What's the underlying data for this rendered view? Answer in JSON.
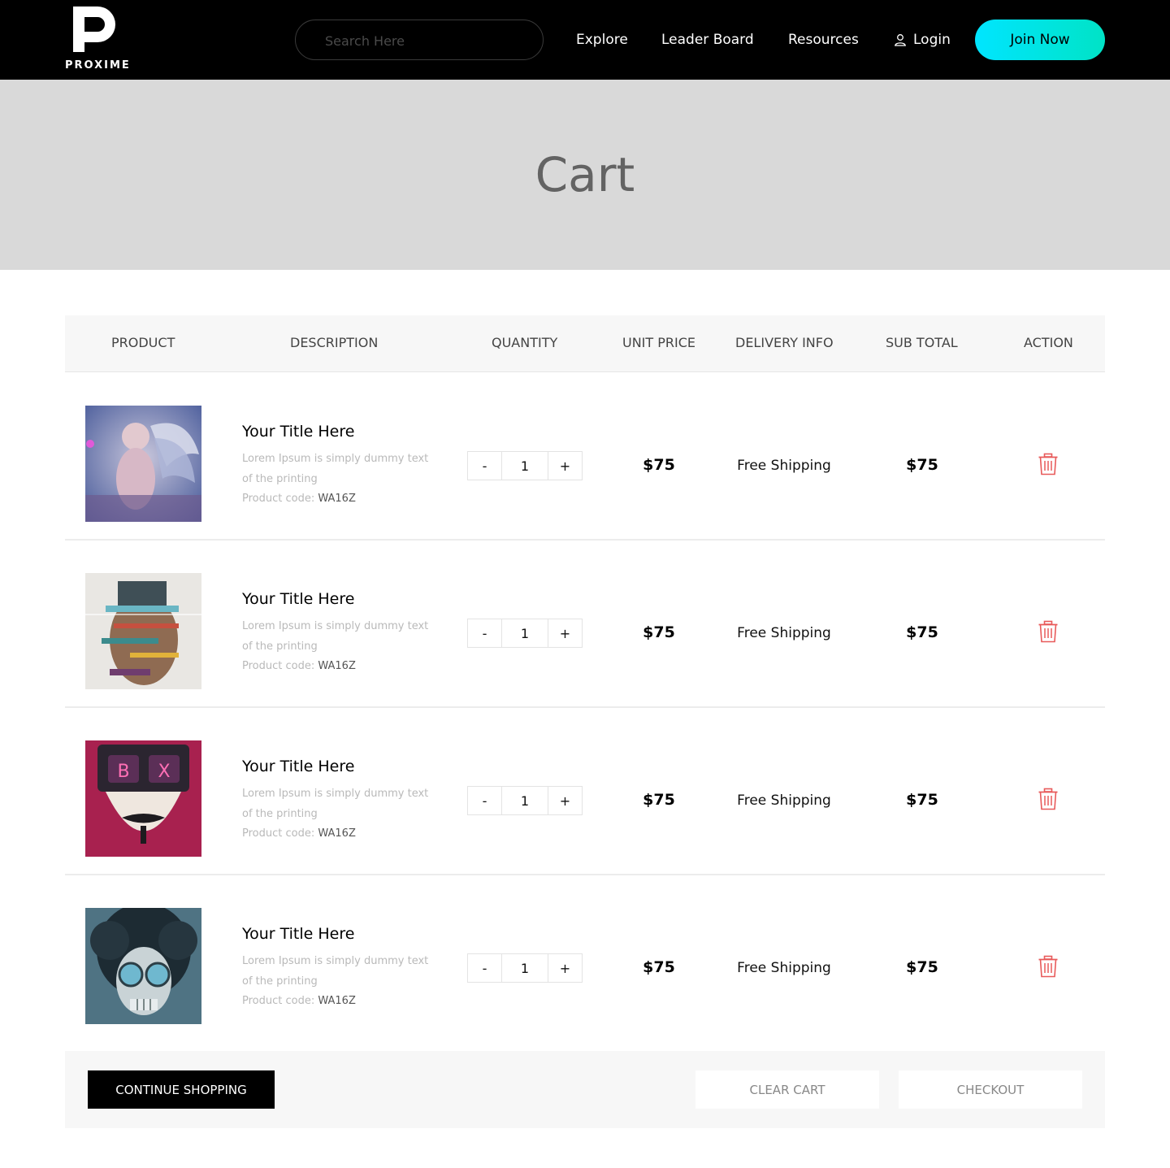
{
  "header": {
    "logo_text": "PROXIME",
    "search_placeholder": "Search Here",
    "nav": {
      "explore": "Explore",
      "leader_board": "Leader Board",
      "resources": "Resources",
      "login": "Login"
    },
    "join_label": "Join Now",
    "join_gradient": [
      "#00e5ff",
      "#00e3c6"
    ]
  },
  "banner": {
    "title": "Cart"
  },
  "table": {
    "headers": {
      "product": "PRODUCT",
      "description": "DESCRIPTION",
      "quantity": "QUANTITY",
      "unit_price": "UNIT PRICE",
      "delivery_info": "DELIVERY INFO",
      "sub_total": "SUB TOTAL",
      "action": "ACTION"
    },
    "rows": [
      {
        "title": "Your Title Here",
        "desc": "Lorem Ipsum is simply dummy text of the printing",
        "code_label": "Product code:",
        "code": "WA16Z",
        "qty": "1",
        "unit_price": "$75",
        "delivery": "Free Shipping",
        "sub_total": "$75",
        "image": "angel-baby-art"
      },
      {
        "title": "Your Title Here",
        "desc": "Lorem Ipsum is simply dummy text of the printing",
        "code_label": "Product code:",
        "code": "WA16Z",
        "qty": "1",
        "unit_price": "$75",
        "delivery": "Free Shipping",
        "sub_total": "$75",
        "image": "glitch-face-art"
      },
      {
        "title": "Your Title Here",
        "desc": "Lorem Ipsum is simply dummy text of the printing",
        "code_label": "Product code:",
        "code": "WA16Z",
        "qty": "1",
        "unit_price": "$75",
        "delivery": "Free Shipping",
        "sub_total": "$75",
        "image": "crypto-mask-art"
      },
      {
        "title": "Your Title Here",
        "desc": "Lorem Ipsum is simply dummy text of the printing",
        "code_label": "Product code:",
        "code": "WA16Z",
        "qty": "1",
        "unit_price": "$75",
        "delivery": "Free Shipping",
        "sub_total": "$75",
        "image": "skull-afro-art"
      }
    ],
    "minus_label": "-",
    "plus_label": "+",
    "delete_icon": "trash-icon",
    "delete_color": "#e85a5a"
  },
  "actions": {
    "continue": "CONTINUE SHOPPING",
    "clear": "CLEAR CART",
    "checkout": "CHECKOUT"
  }
}
